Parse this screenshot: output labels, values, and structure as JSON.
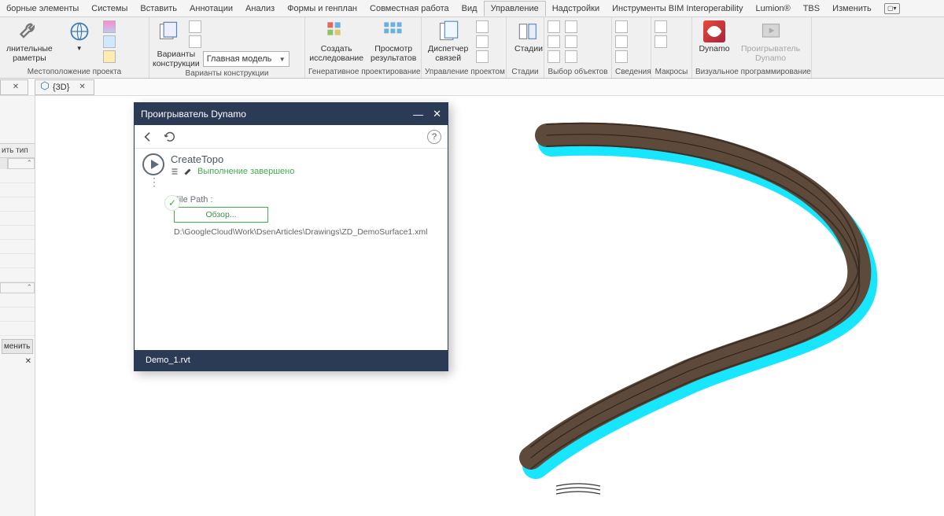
{
  "ribbon_tabs": {
    "t0": "борные элементы",
    "t1": "Системы",
    "t2": "Вставить",
    "t3": "Аннотации",
    "t4": "Анализ",
    "t5": "Формы и генплан",
    "t6": "Совместная работа",
    "t7": "Вид",
    "t8": "Управление",
    "t9": "Надстройки",
    "t10": "Инструменты BIM Interoperability",
    "t11": "Lumion®",
    "t12": "TBS",
    "t13": "Изменить"
  },
  "panels": {
    "p0": {
      "btn1a": "лнительные",
      "btn1b": "раметры",
      "title": "Местоположение проекта"
    },
    "p1": {
      "btn1a": "Варианты",
      "btn1b": "конструкции",
      "dd": "Главная модель",
      "title": "Варианты конструкции"
    },
    "p2": {
      "btn1a": "Создать",
      "btn1b": "исследование",
      "btn2a": "Просмотр",
      "btn2b": "результатов",
      "title": "Генеративное проектирование"
    },
    "p3": {
      "btn1a": "Диспетчер",
      "btn1b": "связей",
      "title": "Управление проектом"
    },
    "p4": {
      "btn1": "Стадии",
      "title": "Стадии"
    },
    "p5": {
      "title": "Выбор объектов"
    },
    "p6": {
      "title": "Сведения"
    },
    "p7": {
      "title": "Макросы"
    },
    "p8": {
      "btn1": "Dynamo",
      "btn2a": "Проигрыватель",
      "btn2b": "Dynamo",
      "title": "Визуальное программирование"
    }
  },
  "view_tab": {
    "name": "{3D}"
  },
  "left": {
    "typ": "ить тип",
    "btn": "менить"
  },
  "modal": {
    "title": "Проигрыватель Dynamo",
    "script_name": "CreateTopo",
    "status": "Выполнение завершено",
    "file_label": "File Path :",
    "browse": "Обзор...",
    "path": "D:\\GoogleCloud\\Work\\DsenArticles\\Drawings\\ZD_DemoSurface1.xml",
    "footer": "Demo_1.rvt"
  }
}
